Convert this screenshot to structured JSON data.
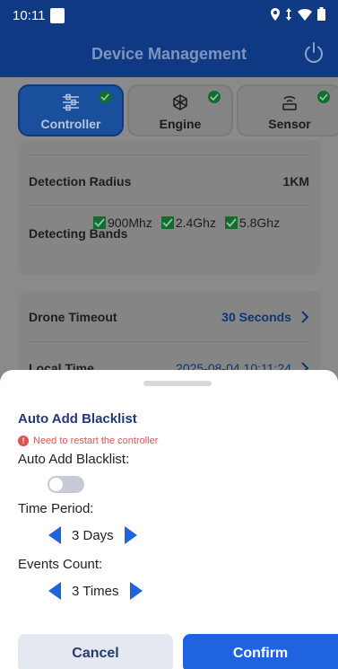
{
  "status_bar": {
    "time": "10:11",
    "icons": [
      "location-icon",
      "data-arrows-icon",
      "wifi-icon",
      "battery-icon"
    ]
  },
  "app_bar": {
    "title": "Device Management",
    "power_icon": "power-icon"
  },
  "tabs": [
    {
      "label": "Controller",
      "icon": "sliders-icon",
      "active": true,
      "checked": true
    },
    {
      "label": "Engine",
      "icon": "engine-icon",
      "active": false,
      "checked": true
    },
    {
      "label": "Sensor",
      "icon": "sensor-icon",
      "active": false,
      "checked": true
    }
  ],
  "settings": {
    "detection_radius_label": "Detection Radius",
    "detection_radius_value": "1KM",
    "detecting_bands_label": "Detecting Bands",
    "bands": [
      "900Mhz",
      "2.4Ghz",
      "5.8Ghz"
    ],
    "drone_timeout_label": "Drone Timeout",
    "drone_timeout_value": "30 Seconds",
    "local_time_label": "Local Time",
    "local_time_value": "2025-08-04 10:11:24"
  },
  "sheet": {
    "title": "Auto Add Blacklist",
    "warning": "Need to restart the controller",
    "auto_add_label": "Auto Add Blacklist:",
    "auto_add_enabled": false,
    "time_period_label": "Time Period:",
    "time_period_value": "3 Days",
    "events_count_label": "Events Count:",
    "events_count_value": "3 Times",
    "cancel_label": "Cancel",
    "confirm_label": "Confirm"
  },
  "colors": {
    "primary_dark": "#0f3a83",
    "accent_blue": "#1f63e0",
    "sheet_title": "#23397a",
    "warning_red": "#e05353"
  }
}
